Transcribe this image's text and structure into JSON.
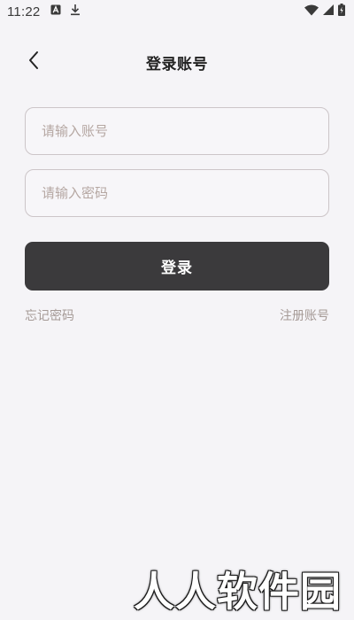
{
  "status_bar": {
    "time": "11:22",
    "left_icons": [
      "font-a-icon",
      "download-icon"
    ],
    "right_icons": [
      "wifi-icon",
      "signal-icon",
      "battery-charging-icon"
    ]
  },
  "header": {
    "back_icon": "chevron-left-icon",
    "title": "登录账号"
  },
  "form": {
    "account_placeholder": "请输入账号",
    "account_value": "",
    "password_placeholder": "请输入密码",
    "password_value": "",
    "login_label": "登录",
    "forgot_label": "忘记密码",
    "register_label": "注册账号"
  },
  "watermark": "人人软件园",
  "colors": {
    "background": "#f5f4f7",
    "button": "#3b3a3c",
    "input_border": "#ccc5c8",
    "placeholder": "#b5a7a2",
    "link": "#a59a96"
  }
}
